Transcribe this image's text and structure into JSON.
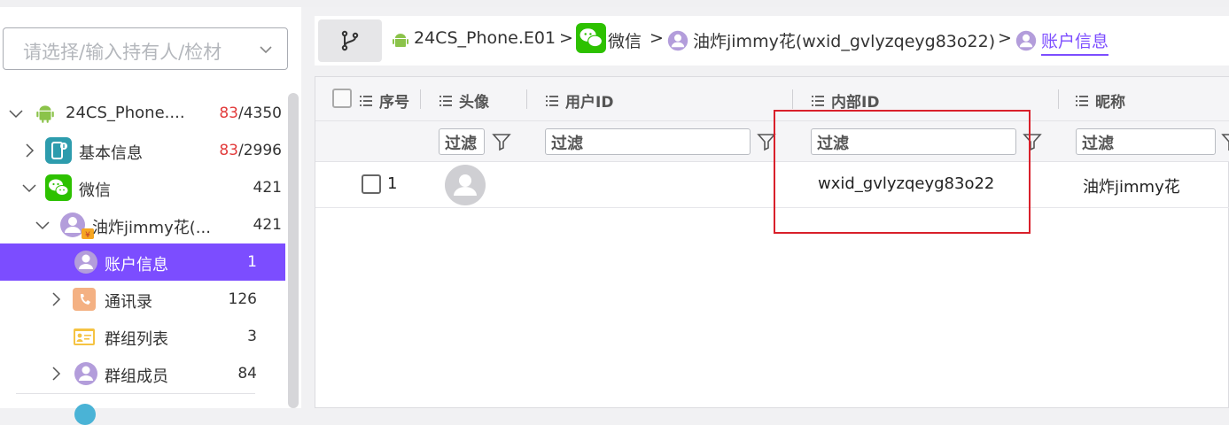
{
  "sidebar": {
    "selector_placeholder": "请选择/输入持有人/检材",
    "tree": [
      {
        "label": "24CS_Phone....",
        "count_red": "83",
        "count_rest": "/4350"
      },
      {
        "label": "基本信息",
        "count_red": "83",
        "count_rest": "/2996"
      },
      {
        "label": "微信",
        "count_red": "",
        "count_rest": "421"
      },
      {
        "label": "油炸jimmy花(...",
        "count_red": "",
        "count_rest": "421"
      },
      {
        "label": "账户信息",
        "count_red": "",
        "count_rest": "1"
      },
      {
        "label": "通讯录",
        "count_red": "",
        "count_rest": "126"
      },
      {
        "label": "群组列表",
        "count_red": "",
        "count_rest": "3"
      },
      {
        "label": "群组成员",
        "count_red": "",
        "count_rest": "84"
      }
    ]
  },
  "breadcrumb": {
    "items": [
      "24CS_Phone.E01",
      "微信",
      "油炸jimmy花(wxid_gvlyzqeyg83o22)",
      "账户信息"
    ],
    "separator": ">"
  },
  "grid": {
    "columns": [
      "序号",
      "头像",
      "用户ID",
      "内部ID",
      "昵称"
    ],
    "filter_placeholder": "过滤",
    "rows": [
      {
        "index": "1",
        "user_id": "",
        "internal_id": "wxid_gvlyzqeyg83o22",
        "nickname": "油炸jimmy花"
      }
    ]
  },
  "colors": {
    "accent": "#7c4dff",
    "highlight_box": "#d9202b",
    "count_red": "#e23b3b",
    "android_green": "#8bc34a",
    "wechat_green": "#2dc100"
  }
}
